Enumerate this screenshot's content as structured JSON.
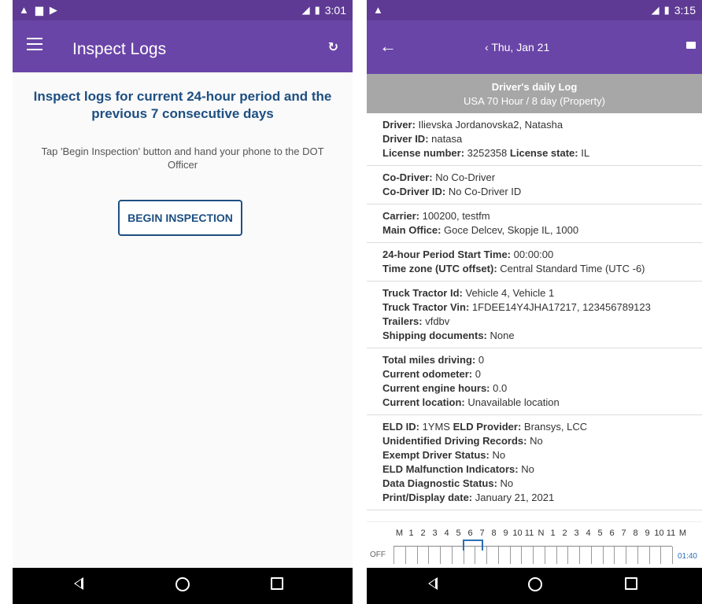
{
  "left": {
    "status_bar": {
      "time": "3:01"
    },
    "app_bar": {
      "title": "Inspect Logs"
    },
    "content": {
      "heading": "Inspect logs for current 24-hour period and the previous 7 consecutive days",
      "instruction": "Tap 'Begin Inspection' button and hand your phone to the DOT Officer",
      "button_label": "BEGIN INSPECTION"
    }
  },
  "right": {
    "status_bar": {
      "time": "3:15"
    },
    "app_bar": {
      "date": "Thu, Jan 21"
    },
    "header": {
      "title": "Driver's daily Log",
      "subtitle": "USA 70 Hour / 8 day (Property)"
    },
    "sections": [
      [
        {
          "label": "Driver:",
          "value": "Ilievska Jordanovska2, Natasha"
        },
        {
          "label": "Driver ID:",
          "value": "natasa"
        },
        {
          "label": "License number:",
          "value": "3252358",
          "label2": "License state:",
          "value2": "IL"
        }
      ],
      [
        {
          "label": "Co-Driver:",
          "value": "No Co-Driver"
        },
        {
          "label": "Co-Driver ID:",
          "value": "No Co-Driver ID"
        }
      ],
      [
        {
          "label": "Carrier:",
          "value": "100200, testfm"
        },
        {
          "label": "Main Office:",
          "value": "Goce Delcev, Skopje IL, 1000"
        }
      ],
      [
        {
          "label": "24-hour Period Start Time:",
          "value": "00:00:00"
        },
        {
          "label": "Time zone (UTC offset):",
          "value": "Central Standard Time (UTC -6)"
        }
      ],
      [
        {
          "label": "Truck Tractor Id:",
          "value": "Vehicle 4, Vehicle 1"
        },
        {
          "label": "Truck Tractor Vin:",
          "value": "1FDEE14Y4JHA17217, 123456789123"
        },
        {
          "label": "Trailers:",
          "value": "vfdbv"
        },
        {
          "label": "Shipping documents:",
          "value": "None"
        }
      ],
      [
        {
          "label": "Total miles driving:",
          "value": "0"
        },
        {
          "label": "Current odometer:",
          "value": "0"
        },
        {
          "label": "Current engine hours:",
          "value": "0.0"
        },
        {
          "label": "Current location:",
          "value": "Unavailable location"
        }
      ],
      [
        {
          "label": "ELD ID:",
          "value": "1YMS",
          "label2": "ELD Provider:",
          "value2": "Bransys, LCC"
        },
        {
          "label": "Unidentified Driving Records:",
          "value": "No"
        },
        {
          "label": "Exempt Driver Status:",
          "value": "No"
        },
        {
          "label": "ELD Malfunction Indicators:",
          "value": "No"
        },
        {
          "label": "Data Diagnostic Status:",
          "value": "No"
        },
        {
          "label": "Print/Display date:",
          "value": "January 21, 2021"
        }
      ]
    ],
    "graph": {
      "hours": [
        "M",
        "1",
        "2",
        "3",
        "4",
        "5",
        "6",
        "7",
        "8",
        "9",
        "10",
        "11",
        "N",
        "1",
        "2",
        "3",
        "4",
        "5",
        "6",
        "7",
        "8",
        "9",
        "10",
        "11",
        "M"
      ],
      "row_label": "OFF",
      "total": "01:40"
    }
  }
}
